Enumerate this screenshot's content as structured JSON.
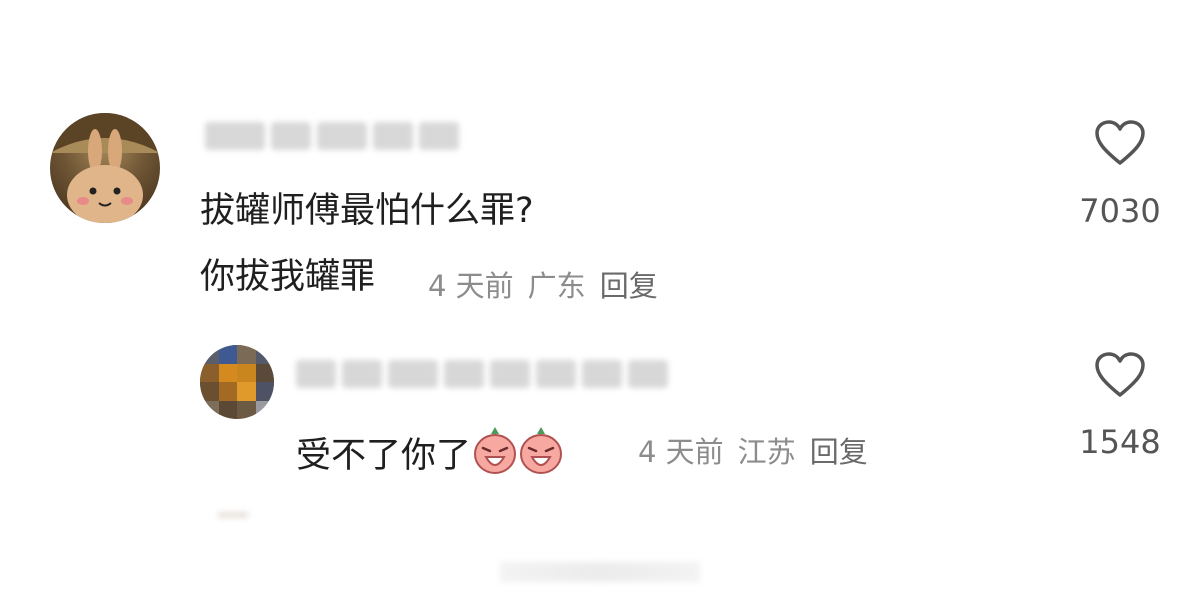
{
  "comment": {
    "avatar_icon": "bunny-avatar",
    "line1": "拔罐师傅最怕什么罪?",
    "line2": "你拔我罐罪",
    "time": "4 天前",
    "location": "广东",
    "reply": "回复",
    "likes": "7030"
  },
  "reply": {
    "text": "受不了你了",
    "emoji_icon": "crying-face-emoji",
    "time": "4 天前",
    "location": "江苏",
    "reply": "回复",
    "likes": "1548"
  },
  "colors": {
    "meta": "#8c8c8c",
    "text": "#1f1f1f",
    "heart": "#555555"
  }
}
